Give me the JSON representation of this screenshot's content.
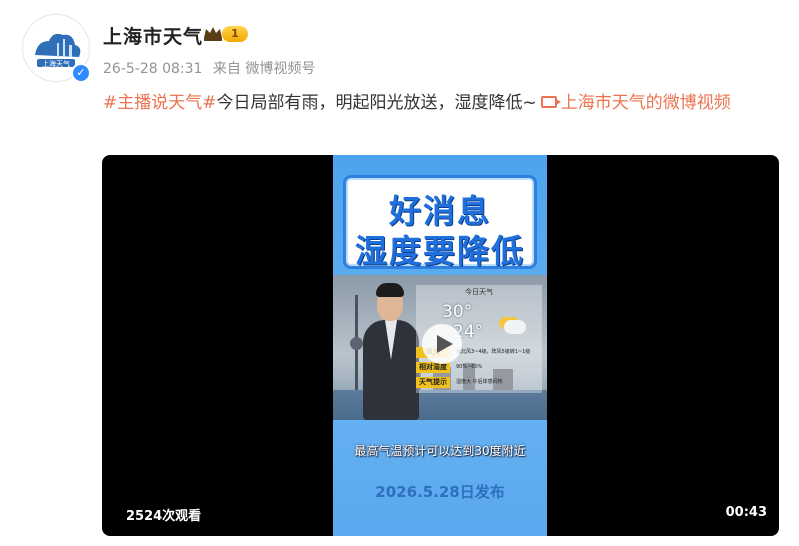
{
  "post": {
    "author": "上海市天气",
    "level": "1",
    "timestamp": "26-5-28 08:31",
    "source": "来自 微博视频号",
    "hashtag": "#主播说天气#",
    "text": "今日局部有雨，明起阳光放送，湿度降低~",
    "link_text": "上海市天气的微博视频"
  },
  "video": {
    "banner_line1": "好消息",
    "banner_line2": "湿度要降低",
    "panel_title": "今日天气",
    "temp_high": "30°",
    "temp_low": "24°",
    "rows": [
      {
        "label": "风力",
        "value": "偏北风3~4级，阵风5级转1~1级"
      },
      {
        "label": "相对湿度",
        "value": "90%~60%"
      },
      {
        "label": "天气提示",
        "value": "湿度大 午后体感闷热"
      }
    ],
    "subtitle": "最高气温预计可以达到30度附近",
    "date": "2026.5.28日发布",
    "views": "2524次观看",
    "duration": "00:43"
  },
  "colors": {
    "accent": "#eb7350",
    "verified": "#2f8cff",
    "video_bg": "#000000"
  },
  "icons": {
    "avatar": "city-skyline-logo",
    "crown": "crown-icon",
    "link": "video-link-icon",
    "play": "play-icon"
  }
}
